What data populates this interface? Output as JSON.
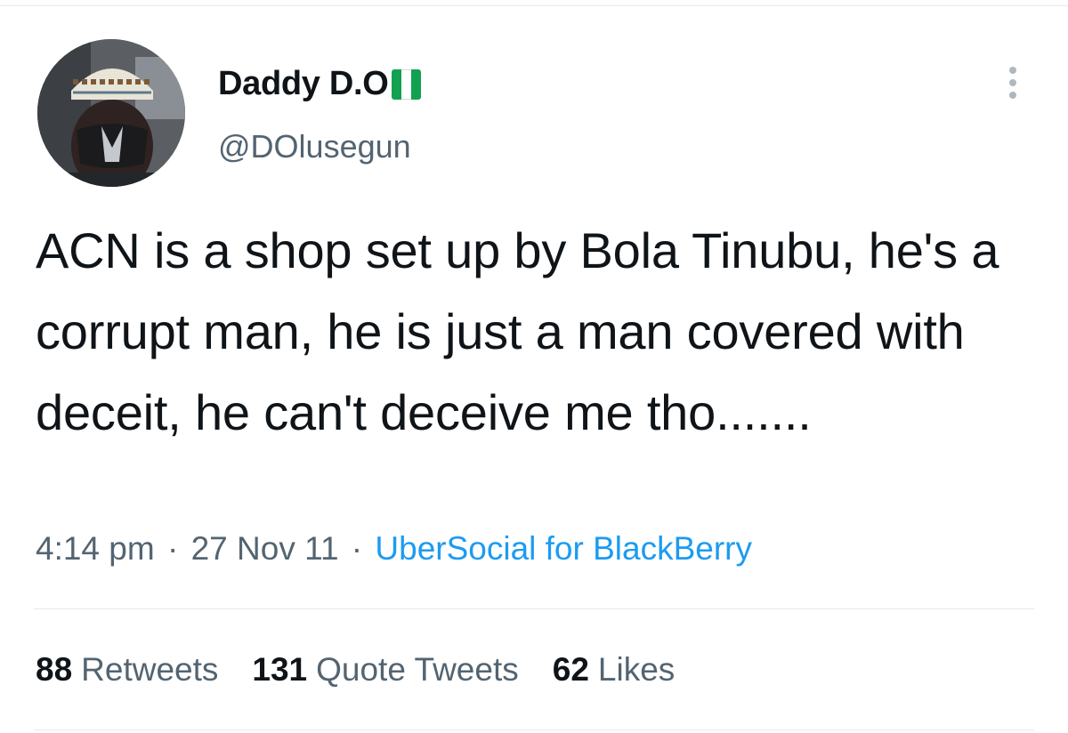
{
  "tweet": {
    "author": {
      "display_name": "Daddy D.O",
      "flag_emoji": "Nigeria flag",
      "handle": "@DOlusegun"
    },
    "text": "ACN is a shop set up by Bola Tinubu, he's a corrupt man, he is just a man covered with deceit, he can't deceive me tho.......",
    "time": "4:14 pm",
    "separator": "·",
    "date": "27 Nov 11",
    "source": "UberSocial for BlackBerry",
    "stats": {
      "retweets_count": "88",
      "retweets_label": "Retweets",
      "quotes_count": "131",
      "quotes_label": "Quote Tweets",
      "likes_count": "62",
      "likes_label": "Likes"
    }
  },
  "colors": {
    "text": "#0f1419",
    "secondary": "#536471",
    "link": "#1d9bf0",
    "flag_green": "#12a150"
  },
  "icons": [
    "more-icon",
    "nigeria-flag-icon"
  ]
}
